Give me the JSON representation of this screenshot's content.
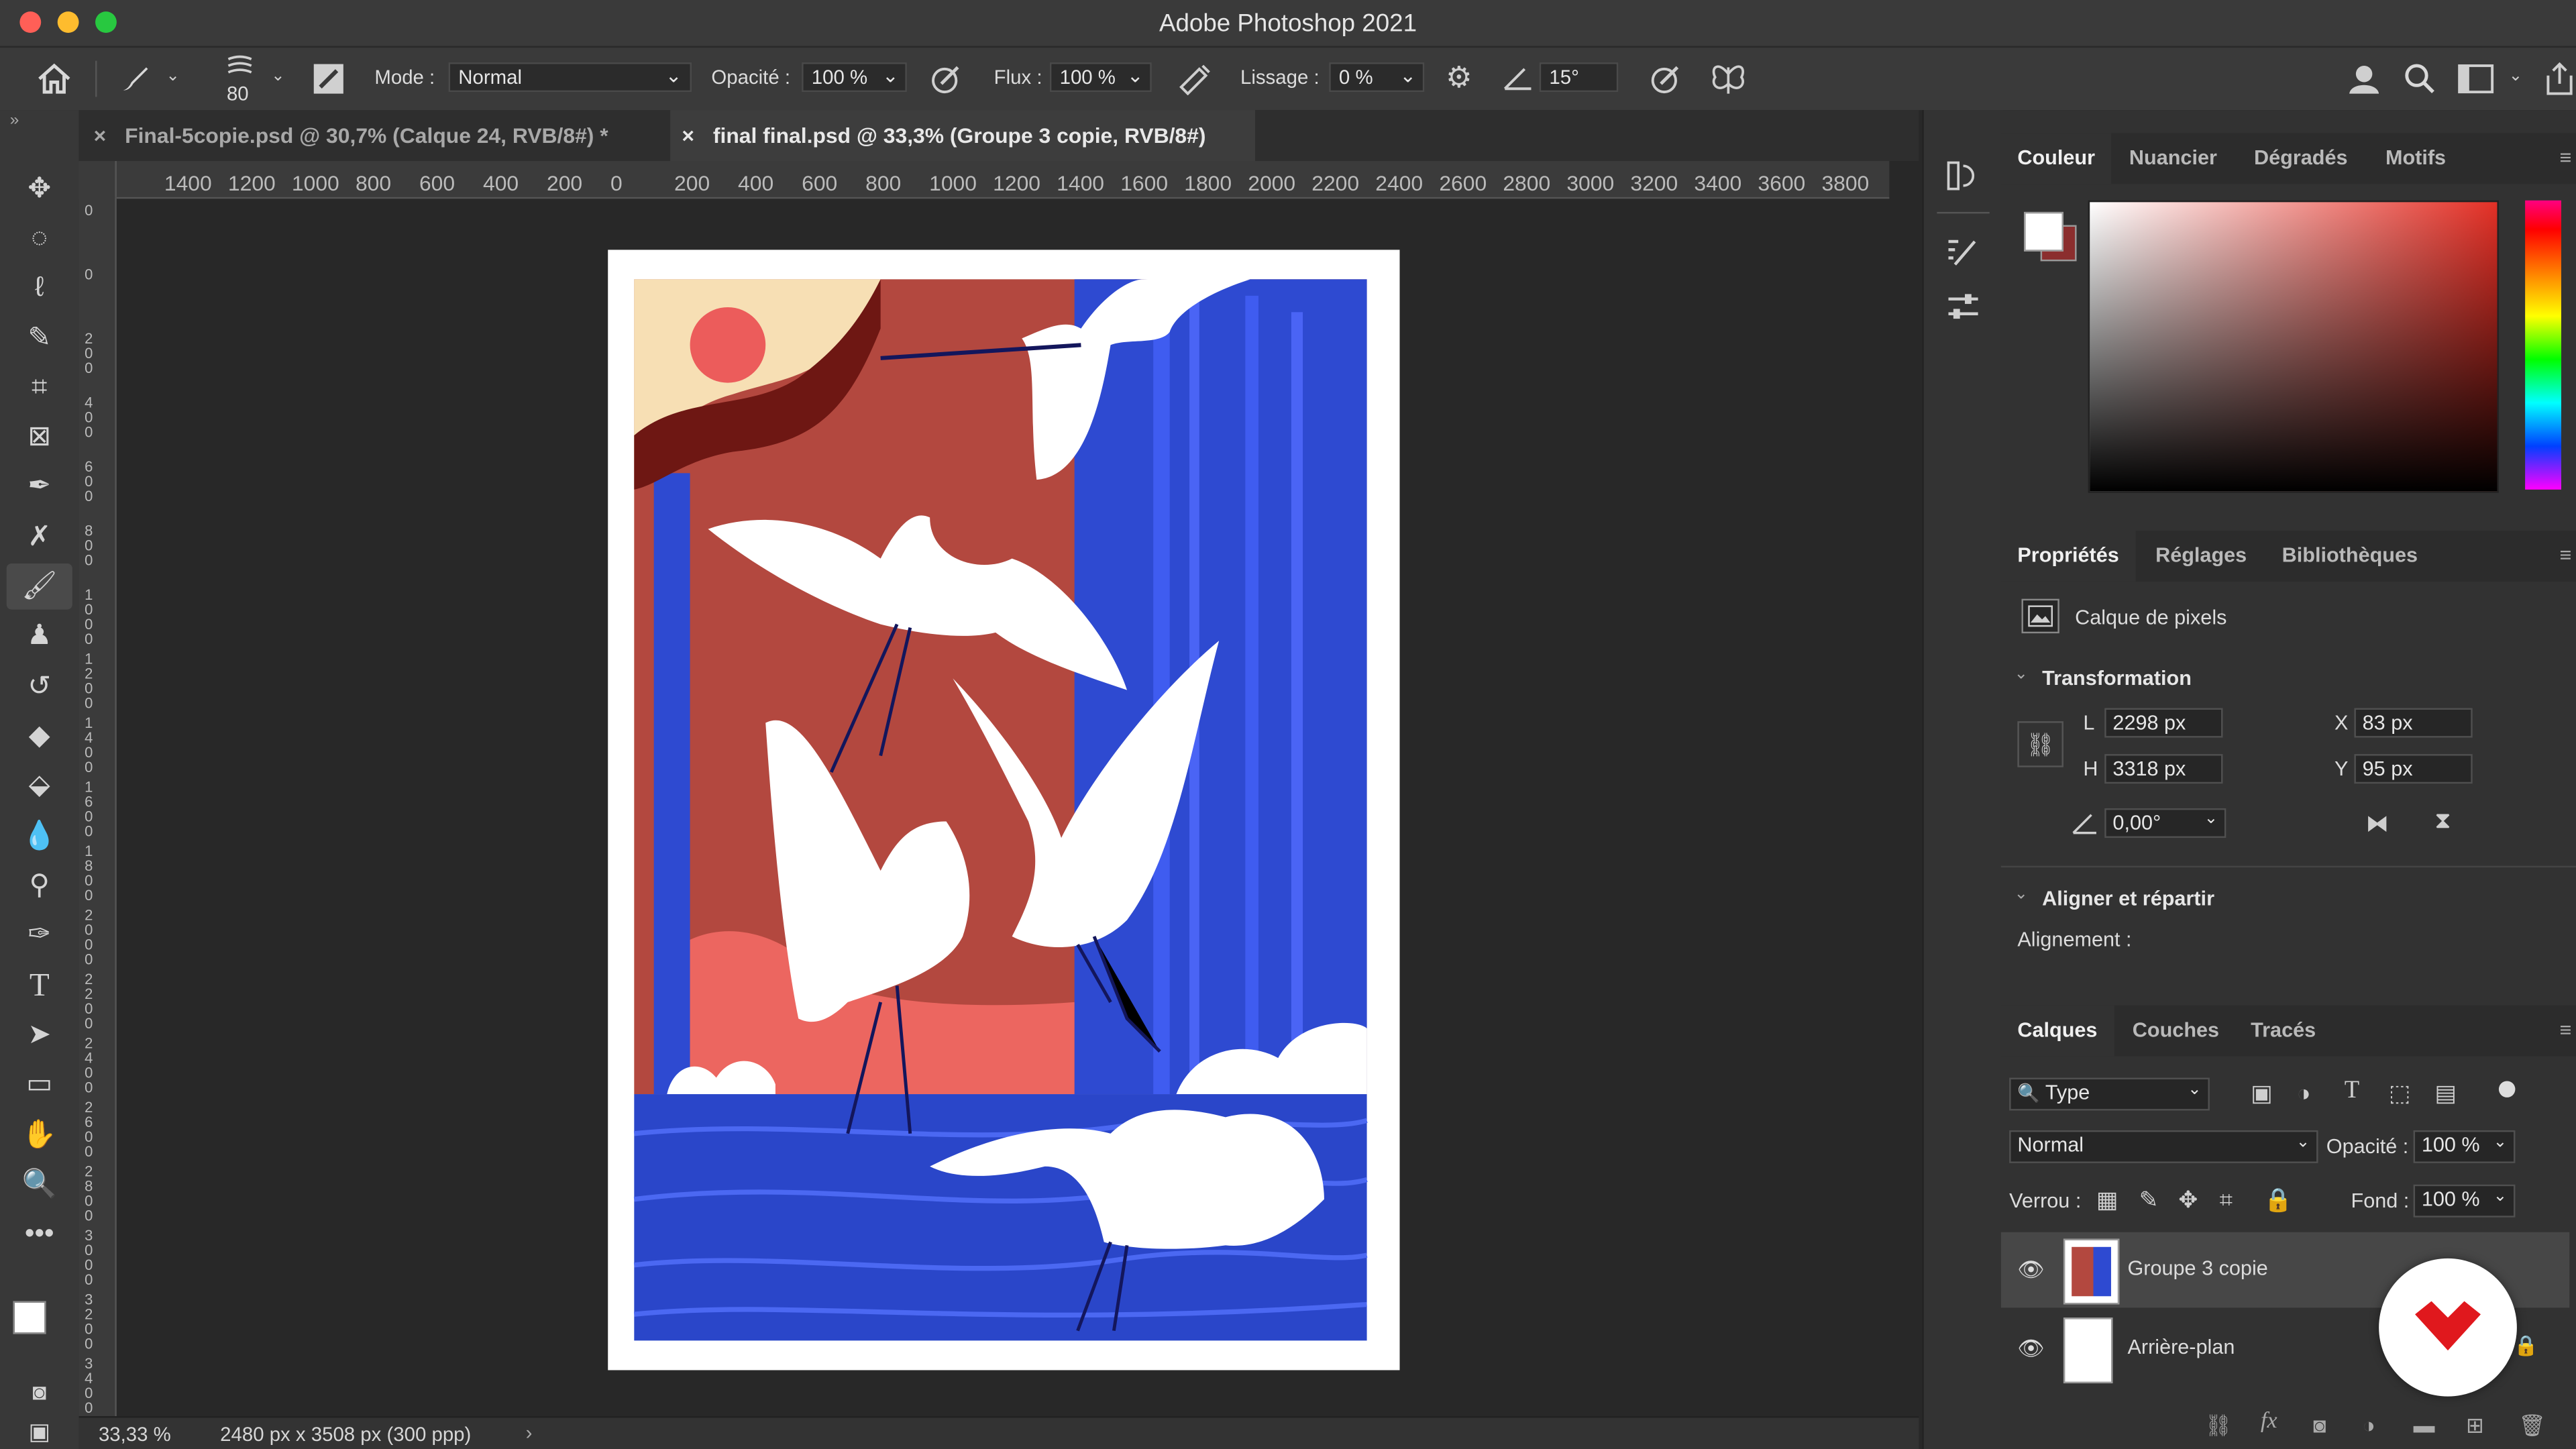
{
  "window": {
    "title": "Adobe Photoshop 2021"
  },
  "options_bar": {
    "brush_size": "80",
    "mode_label": "Mode :",
    "mode_value": "Normal",
    "opacity_label": "Opacité :",
    "opacity_value": "100 %",
    "flow_label": "Flux :",
    "flow_value": "100 %",
    "smoothing_label": "Lissage :",
    "smoothing_value": "0 %",
    "angle_value": "15°"
  },
  "tabs": [
    {
      "label": "Final-5copie.psd @ 30,7% (Calque 24, RVB/8#) *",
      "active": false
    },
    {
      "label": "final final.psd @ 33,3% (Groupe 3 copie, RVB/8#)",
      "active": true
    }
  ],
  "ruler": {
    "h_labels": [
      "1400",
      "1200",
      "1000",
      "800",
      "600",
      "400",
      "200",
      "0",
      "200",
      "400",
      "600",
      "800",
      "1000",
      "1200",
      "1400",
      "1600",
      "1800",
      "2000",
      "2200",
      "2400",
      "2600",
      "2800",
      "3000",
      "3200",
      "3400",
      "3600",
      "3800"
    ],
    "v_labels": [
      "0",
      "0",
      "200",
      "400",
      "600",
      "800",
      "1000",
      "1200",
      "1400",
      "1600",
      "1800",
      "2000",
      "2200",
      "2400",
      "2600",
      "2800",
      "3000",
      "3200",
      "3400"
    ]
  },
  "status": {
    "zoom": "33,33 %",
    "doc_info": "2480 px x 3508 px (300 ppp)"
  },
  "color_panel": {
    "tabs": [
      "Couleur",
      "Nuancier",
      "Dégradés",
      "Motifs"
    ],
    "active_tab": "Couleur",
    "foreground": "#ffffff",
    "background": "#8b2e2e"
  },
  "properties_panel": {
    "tabs": [
      "Propriétés",
      "Réglages",
      "Bibliothèques"
    ],
    "layer_kind": "Calque de pixels",
    "transform_title": "Transformation",
    "w_label": "L",
    "w_value": "2298 px",
    "h_label": "H",
    "h_value": "3318 px",
    "x_label": "X",
    "x_value": "83 px",
    "y_label": "Y",
    "y_value": "95 px",
    "angle_value": "0,00°",
    "align_title": "Aligner et répartir",
    "align_label": "Alignement :"
  },
  "layers_panel": {
    "tabs": [
      "Calques",
      "Couches",
      "Tracés"
    ],
    "filter_label": "Type",
    "blend_mode": "Normal",
    "opacity_label": "Opacité :",
    "opacity_value": "100 %",
    "lock_label": "Verrou :",
    "fill_label": "Fond :",
    "fill_value": "100 %",
    "layers": [
      {
        "name": "Groupe 3 copie",
        "selected": true
      },
      {
        "name": "Arrière-plan",
        "selected": false
      }
    ]
  }
}
